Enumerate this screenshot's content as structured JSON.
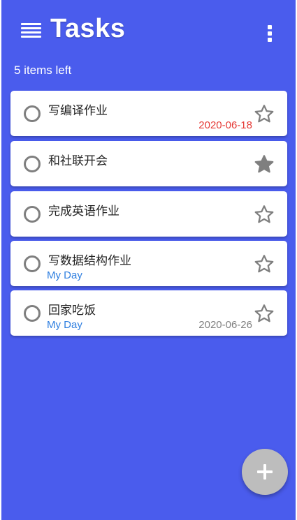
{
  "header": {
    "title": "Tasks",
    "menu_icon": "menu-icon",
    "more_icon": "more-vertical-icon"
  },
  "summary": {
    "items_left": "5 items left"
  },
  "tasks": [
    {
      "title": "写编译作业",
      "tag": "",
      "date": "2020-06-18",
      "date_status": "overdue",
      "starred": false
    },
    {
      "title": "和社联开会",
      "tag": "",
      "date": "",
      "date_status": "",
      "starred": true
    },
    {
      "title": "完成英语作业",
      "tag": "",
      "date": "",
      "date_status": "",
      "starred": false
    },
    {
      "title": "写数据结构作业",
      "tag": "My Day",
      "date": "",
      "date_status": "",
      "starred": false
    },
    {
      "title": "回家吃饭",
      "tag": "My Day",
      "date": "2020-06-26",
      "date_status": "upcoming",
      "starred": false
    }
  ],
  "fab": {
    "icon": "plus-icon"
  },
  "colors": {
    "background": "#4a5ced",
    "card": "#ffffff",
    "tag": "#2f7fe0",
    "overdue_date": "#e53935",
    "normal_date": "#808080",
    "star": "#7f7f7f",
    "fab": "#bdbdbd"
  }
}
